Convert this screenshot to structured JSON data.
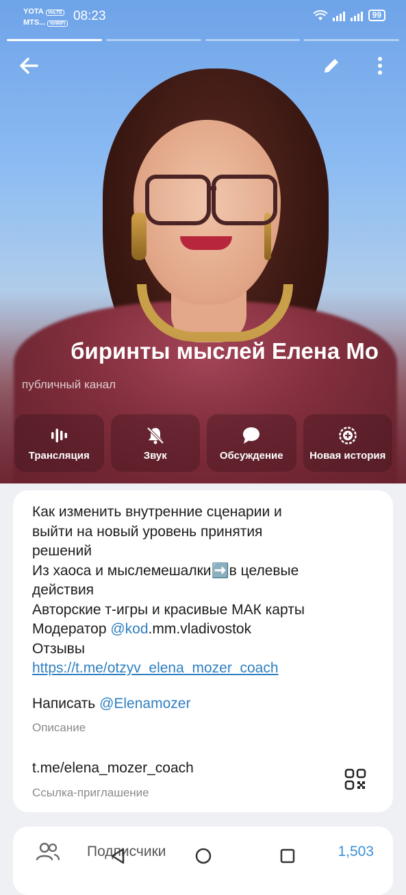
{
  "status_bar": {
    "carrier_1": "YOTA",
    "carrier_1_tag": "VoLTE",
    "carrier_2": "MTS...",
    "carrier_2_tag": "VoWiFi",
    "time": "08:23",
    "battery": "99"
  },
  "story_segments": 4,
  "header": {
    "back_icon": "arrow-left-icon",
    "edit_icon": "pencil-icon",
    "more_icon": "more-vertical-icon"
  },
  "channel": {
    "title": "Лабиринты мыслей    Елена Мозер",
    "title_visible": "биринты мыслей    Елена Мо",
    "type": "публичный канал"
  },
  "actions": [
    {
      "label": "Трансляция",
      "icon": "broadcast-icon"
    },
    {
      "label": "Звук",
      "icon": "bell-muted-icon"
    },
    {
      "label": "Обсуждение",
      "icon": "chat-bubble-icon"
    },
    {
      "label": "Новая история",
      "icon": "new-story-icon"
    }
  ],
  "info": {
    "description_lines": [
      "Как изменить внутренние сценарии и",
      "выйти на новый уровень принятия",
      "решений",
      "Из хаоса и мыслемешалки➡️в целевые",
      "действия",
      "Авторские т-игры и красивые МАК карты"
    ],
    "moderator_prefix": "Модератор ",
    "moderator_mention": "@kod",
    "moderator_suffix": ".mm.vladivostok",
    "reviews_label": "Отзывы",
    "reviews_link": "https://t.me/otzyv_elena_mozer_coach",
    "write_prefix": "Написать ",
    "write_mention": "@Elenamozer",
    "description_label": "Описание",
    "invite_link": "t.me/elena_mozer_coach",
    "invite_label": "Ссылка-приглашение"
  },
  "members": {
    "label": "Подписчики",
    "count": "1,503",
    "icon": "people-icon"
  },
  "system_nav": [
    "back-triangle-icon",
    "home-circle-icon",
    "recents-square-icon"
  ]
}
